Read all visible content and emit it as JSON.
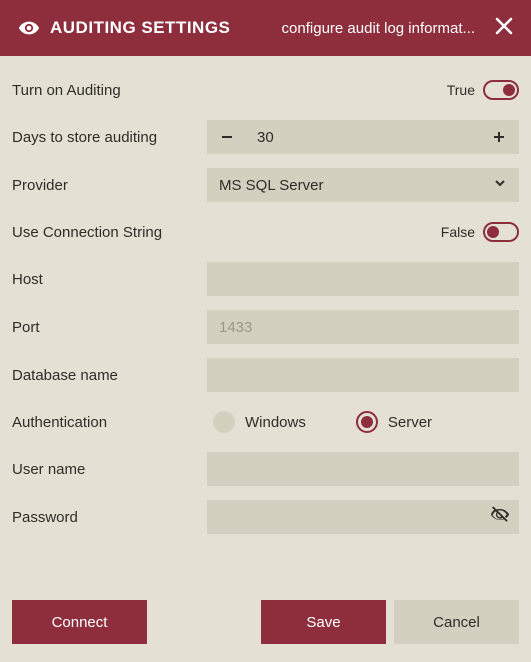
{
  "header": {
    "title": "AUDITING SETTINGS",
    "subtitle": "configure audit log informat..."
  },
  "fields": {
    "turn_on": {
      "label": "Turn on Auditing",
      "value_text": "True",
      "value": true
    },
    "days": {
      "label": "Days to store auditing",
      "value": "30"
    },
    "provider": {
      "label": "Provider",
      "value": "MS SQL Server"
    },
    "conn_string": {
      "label": "Use Connection String",
      "value_text": "False",
      "value": false
    },
    "host": {
      "label": "Host",
      "value": ""
    },
    "port": {
      "label": "Port",
      "placeholder": "1433",
      "value": ""
    },
    "dbname": {
      "label": "Database name",
      "value": ""
    },
    "auth": {
      "label": "Authentication",
      "option_windows": "Windows",
      "option_server": "Server",
      "selected": "Server"
    },
    "username": {
      "label": "User name",
      "value": ""
    },
    "password": {
      "label": "Password",
      "value": ""
    }
  },
  "buttons": {
    "connect": "Connect",
    "save": "Save",
    "cancel": "Cancel"
  }
}
